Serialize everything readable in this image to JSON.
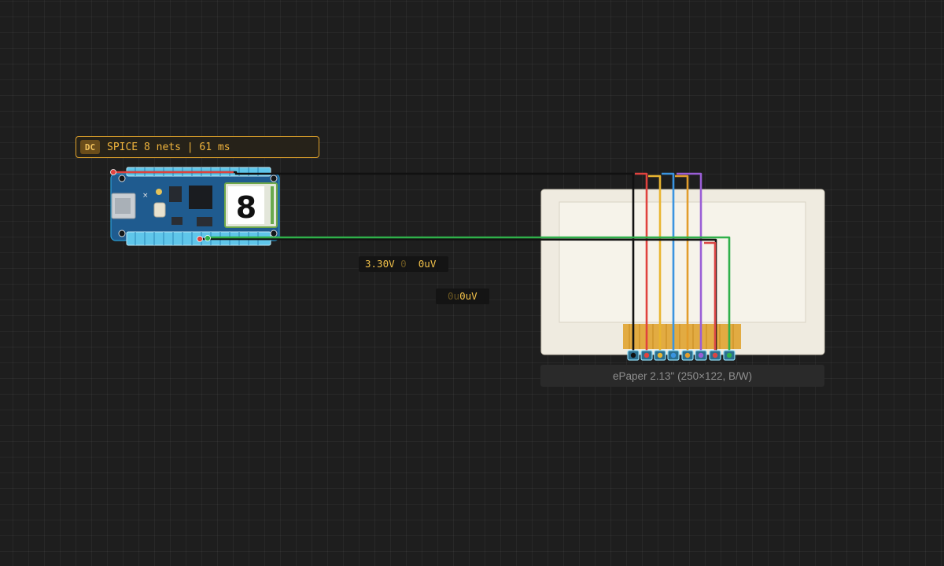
{
  "status": {
    "badge": "DC",
    "text": "SPICE 8 nets | 61 ms"
  },
  "probes": [
    {
      "value": "3.30V",
      "ghost": "0",
      "second": "0uV"
    },
    {
      "ghost": "0u",
      "value": "0uV"
    }
  ],
  "components": {
    "mcu": {
      "logo_glyph": "8"
    },
    "display": {
      "label": "ePaper 2.13\" (250×122, B/W)"
    }
  },
  "colors": {
    "canvas": "#1e1e1e",
    "board": "#1f5b8f",
    "pin_header": "#5fc6ea",
    "epaper_frame": "#efebe0",
    "epaper_screen": "#f6f3ea",
    "fpc": "#e0a431",
    "accent": "#e4a52c"
  },
  "wires": [
    {
      "color": "#111111",
      "net": "black"
    },
    {
      "color": "#e0423e",
      "net": "red"
    },
    {
      "color": "#e9b530",
      "net": "yellow"
    },
    {
      "color": "#3a94e0",
      "net": "blue"
    },
    {
      "color": "#e29d2c",
      "net": "orange"
    },
    {
      "color": "#9a5ed6",
      "net": "purple"
    },
    {
      "color": "#d94545",
      "net": "red2"
    },
    {
      "color": "#2fb04a",
      "net": "green"
    }
  ]
}
